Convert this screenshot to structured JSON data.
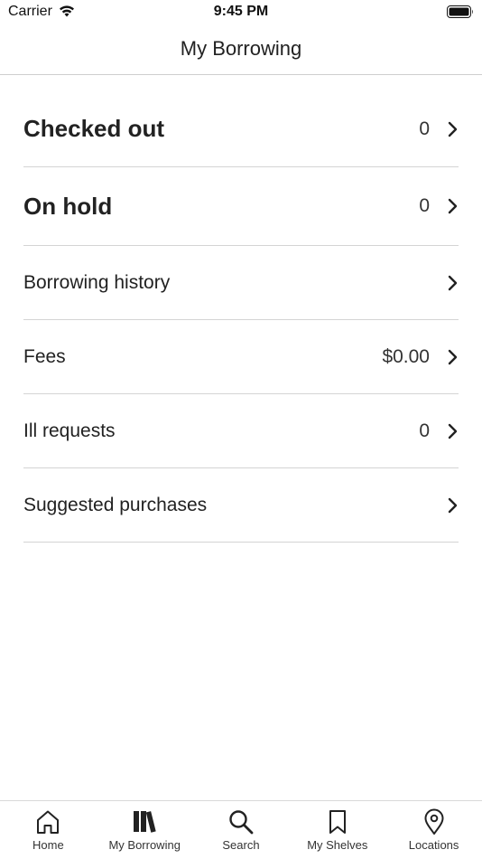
{
  "status_bar": {
    "carrier": "Carrier",
    "time": "9:45 PM"
  },
  "nav": {
    "title": "My Borrowing"
  },
  "menu": {
    "items": [
      {
        "label": "Checked out",
        "value": "0"
      },
      {
        "label": "On hold",
        "value": "0"
      },
      {
        "label": "Borrowing history",
        "value": ""
      },
      {
        "label": "Fees",
        "value": "$0.00"
      },
      {
        "label": "Ill requests",
        "value": "0"
      },
      {
        "label": "Suggested purchases",
        "value": ""
      }
    ]
  },
  "tabs": [
    {
      "label": "Home",
      "icon": "home-icon"
    },
    {
      "label": "My Borrowing",
      "icon": "books-icon"
    },
    {
      "label": "Search",
      "icon": "search-icon"
    },
    {
      "label": "My Shelves",
      "icon": "bookmark-icon"
    },
    {
      "label": "Locations",
      "icon": "location-pin-icon"
    }
  ],
  "colors": {
    "text": "#222222",
    "divider": "#d4d4d4",
    "background": "#ffffff"
  }
}
